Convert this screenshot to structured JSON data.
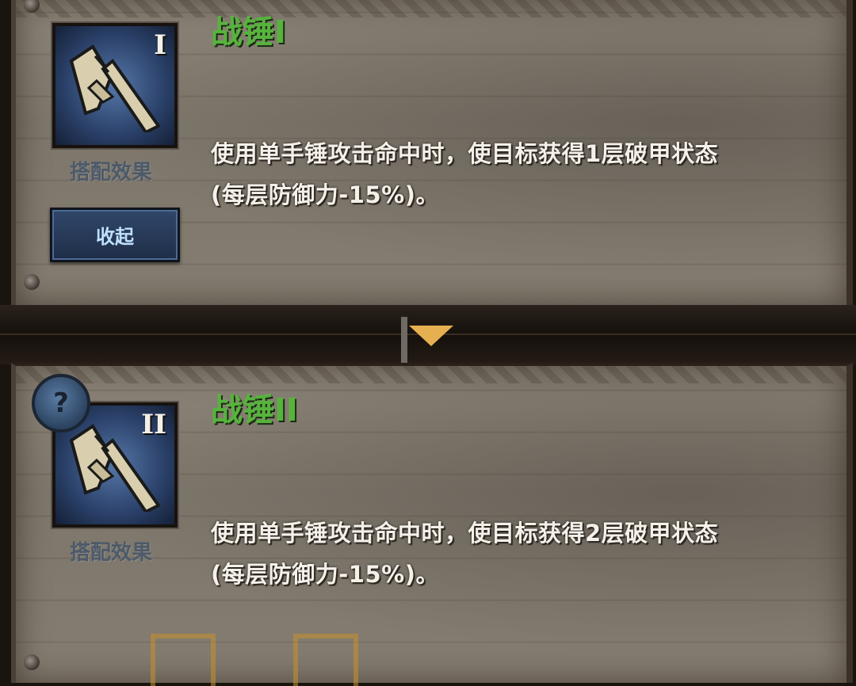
{
  "entries": [
    {
      "title": "战锤I",
      "tier": "I",
      "match_label": "搭配效果",
      "desc_line1": "使用单手锤攻击命中时，使目标获得1层破甲状态",
      "desc_line2": "(每层防御力-15%)。"
    },
    {
      "title": "战锤II",
      "tier": "II",
      "match_label": "搭配效果",
      "desc_line1": "使用单手锤攻击命中时，使目标获得2层破甲状态",
      "desc_line2": "(每层防御力-15%)。"
    }
  ],
  "collapse_button": "收起",
  "help_icon_glyph": "?",
  "colors": {
    "title": "#57b33d",
    "divider_arrow": "#e6b050",
    "button_text": "#bfe0ff"
  },
  "icons": [
    "hammer-icon",
    "help-icon",
    "chevron-down-icon"
  ]
}
